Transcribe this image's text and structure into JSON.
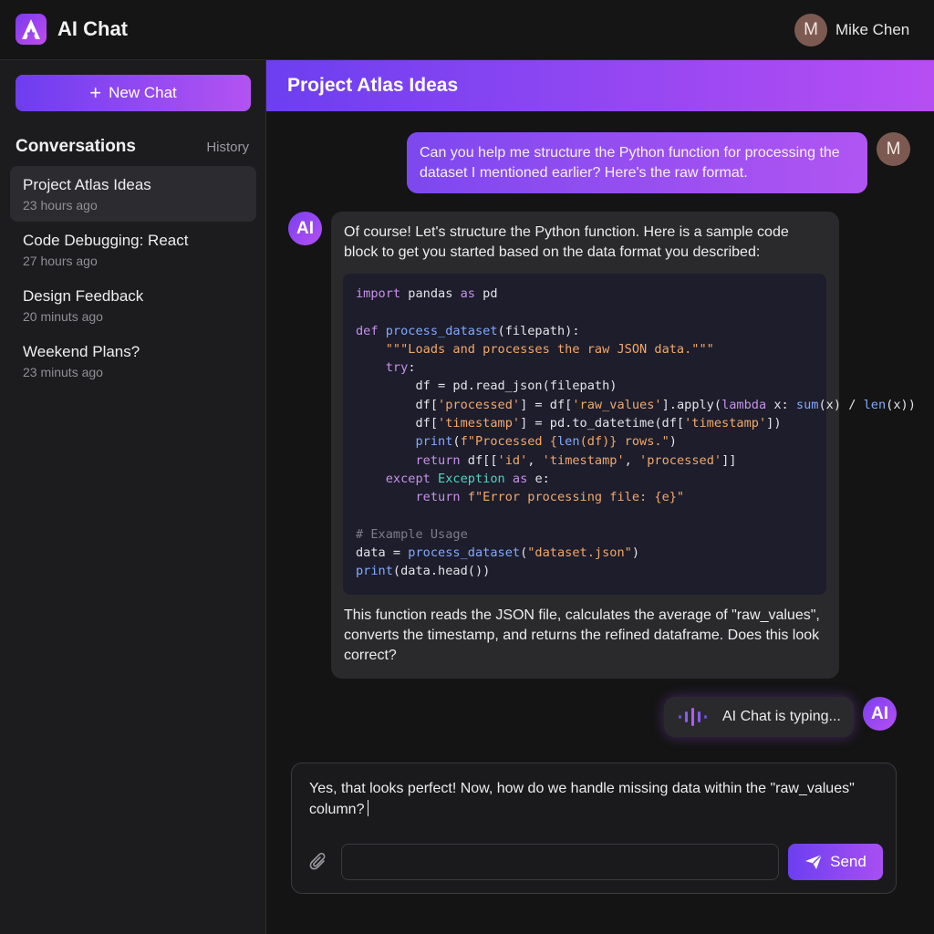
{
  "app": {
    "title": "AI Chat"
  },
  "user": {
    "name": "Mike Chen",
    "initial": "M"
  },
  "sidebar": {
    "new_chat_label": "New Chat",
    "heading": "Conversations",
    "history_label": "History",
    "items": [
      {
        "title": "Project Atlas Ideas",
        "time": "23 hours ago",
        "active": true
      },
      {
        "title": "Code Debugging: React",
        "time": "27 hours ago",
        "active": false
      },
      {
        "title": "Design Feedback",
        "time": "20 minuts ago",
        "active": false
      },
      {
        "title": "Weekend Plans?",
        "time": "23 minuts ago",
        "active": false
      }
    ]
  },
  "chat": {
    "title": "Project Atlas Ideas",
    "ai_avatar": "AI",
    "messages": {
      "user_1": "Can you help me structure the Python function for processing the dataset I mentioned earlier? Here's the raw format.",
      "ai_1_intro": "Of course! Let's structure the Python function. Here is a sample code block to get you started based on the data format you described:",
      "ai_1_code": "import pandas as pd\n\ndef process_dataset(filepath):\n    \"\"\"Loads and processes the raw JSON data.\"\"\"\n    try:\n        df = pd.read_json(filepath)\n        df['processed'] = df['raw_values'].apply(lambda x: sum(x) / len(x))\n        df['timestamp'] = pd.to_datetime(df['timestamp'])\n        print(f\"Processed {len(df)} rows.\")\n        return df[['id', 'timestamp', 'processed']]\n    except Exception as e:\n        return f\"Error processing file: {e}\"\n\n# Example Usage\ndata = process_dataset(\"dataset.json\")\nprint(data.head())",
      "ai_1_outro": "This function reads the JSON file, calculates the average of \"raw_values\", converts the timestamp, and returns the refined dataframe. Does this look correct?"
    },
    "typing_label": "AI Chat is typing..."
  },
  "composer": {
    "draft": "Yes, that looks perfect! Now, how do we handle missing data within the \"raw_values\" column?",
    "attachment_value": "",
    "send_label": "Send"
  },
  "colors": {
    "accent_start": "#6c3ff0",
    "accent_end": "#b74ef4",
    "background": "#141414",
    "sidebar": "#1c1c1e",
    "bubble_ai": "#2a2a2d",
    "code_bg": "#1d1d2b"
  },
  "icons": [
    "logo-a-icon",
    "plus-icon",
    "paperclip-icon",
    "send-plane-icon",
    "voice-wave-icon"
  ]
}
